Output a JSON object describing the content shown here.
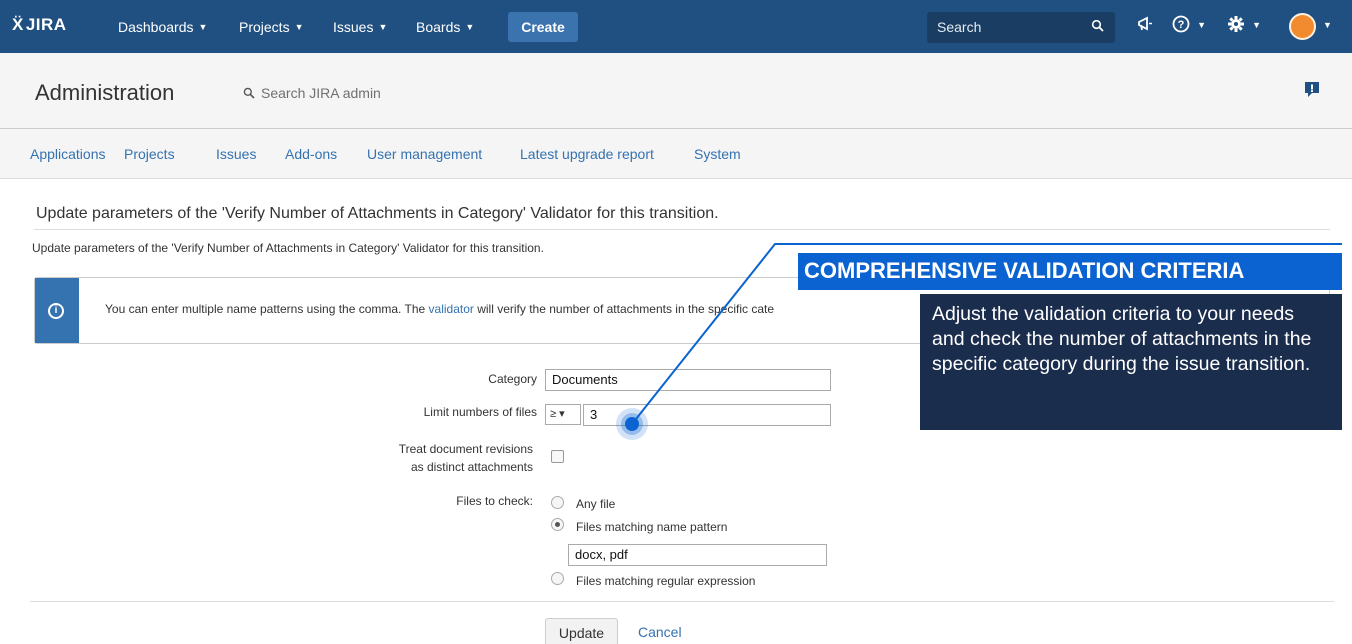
{
  "topnav": {
    "logo": "JIRA",
    "items": [
      "Dashboards",
      "Projects",
      "Issues",
      "Boards"
    ],
    "create_label": "Create",
    "search_placeholder": "Search",
    "colors": {
      "bar": "#205081",
      "create": "#3b73af"
    }
  },
  "admin": {
    "title": "Administration",
    "search_label": "Search JIRA admin"
  },
  "subnav": {
    "items": [
      "Applications",
      "Projects",
      "Issues",
      "Add-ons",
      "User management",
      "Latest upgrade report",
      "System"
    ]
  },
  "page": {
    "heading": "Update parameters of the 'Verify Number of Attachments in Category' Validator for this transition.",
    "description": "Update parameters of the 'Verify Number of Attachments in Category' Validator for this transition.",
    "info_before": "You can enter multiple name patterns using the comma. The ",
    "info_link": "validator",
    "info_after": " will verify the number of attachments in the specific cate"
  },
  "form": {
    "category_label": "Category",
    "category_value": "Documents",
    "limit_label": "Limit numbers of files",
    "operator_value": "≥ ▾",
    "limit_value": "3",
    "revisions_label_line1": "Treat document revisions",
    "revisions_label_line2": "as distinct attachments",
    "files_label": "Files to check:",
    "options": [
      "Any file",
      "Files matching name pattern",
      "Files matching regular expression"
    ],
    "selected_option": "Files matching name pattern",
    "pattern_value": "docx, pdf",
    "update_label": "Update",
    "cancel_label": "Cancel"
  },
  "callout": {
    "title": "COMPREHENSIVE VALIDATION CRITERIA",
    "body": "Adjust the validation criteria to your needs and check the number of attachments in the specific category during the issue transition.",
    "colors": {
      "title_bg": "#0b63d2",
      "body_bg": "#1b2d4d"
    }
  }
}
